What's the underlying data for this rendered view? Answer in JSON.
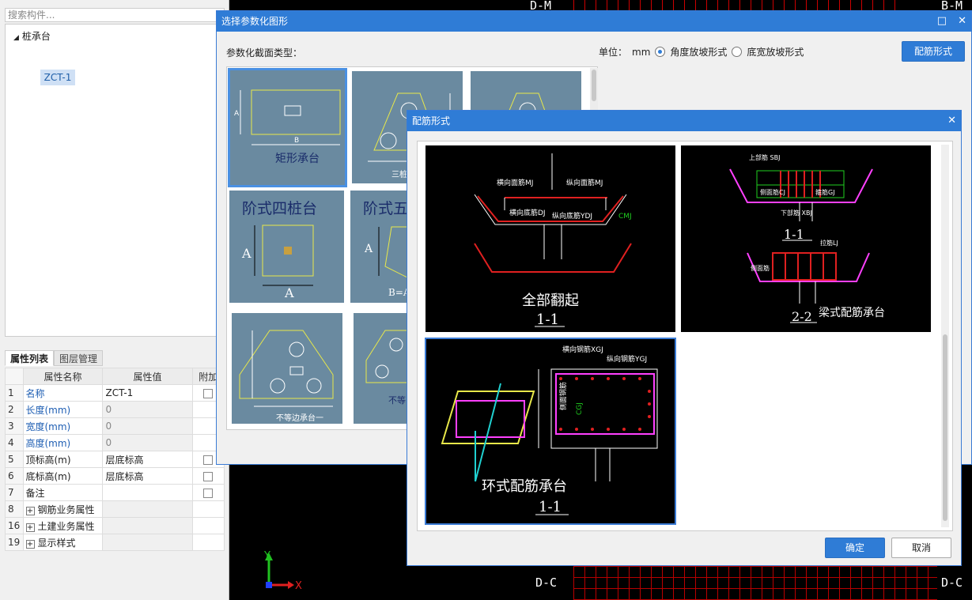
{
  "cad": {
    "labels_top": [
      "D-M",
      "B-M"
    ],
    "labels_bottom": [
      "D-C",
      "D-C"
    ],
    "axis": {
      "y": "Y",
      "x": "X"
    }
  },
  "left": {
    "search_placeholder": "搜索构件...",
    "tree_root": "桩承台",
    "tree_child": "ZCT-1",
    "tabs": [
      "属性列表",
      "图层管理"
    ],
    "columns": [
      "属性名称",
      "属性值",
      "附加"
    ],
    "rows": [
      {
        "n": "1",
        "name": "名称",
        "value": "ZCT-1",
        "blue": true,
        "gray": false,
        "chk": true,
        "plus": false
      },
      {
        "n": "2",
        "name": "长度(mm)",
        "value": "0",
        "blue": true,
        "gray": true,
        "chk": false,
        "plus": false
      },
      {
        "n": "3",
        "name": "宽度(mm)",
        "value": "0",
        "blue": true,
        "gray": true,
        "chk": false,
        "plus": false
      },
      {
        "n": "4",
        "name": "高度(mm)",
        "value": "0",
        "blue": true,
        "gray": true,
        "chk": false,
        "plus": false
      },
      {
        "n": "5",
        "name": "顶标高(m)",
        "value": "层底标高",
        "blue": false,
        "gray": false,
        "chk": true,
        "plus": false
      },
      {
        "n": "6",
        "name": "底标高(m)",
        "value": "层底标高",
        "blue": false,
        "gray": false,
        "chk": true,
        "plus": false
      },
      {
        "n": "7",
        "name": "备注",
        "value": "",
        "blue": false,
        "gray": false,
        "chk": true,
        "plus": false
      },
      {
        "n": "8",
        "name": "钢筋业务属性",
        "value": "",
        "blue": false,
        "gray": true,
        "chk": false,
        "plus": true
      },
      {
        "n": "16",
        "name": "土建业务属性",
        "value": "",
        "blue": false,
        "gray": true,
        "chk": false,
        "plus": true
      },
      {
        "n": "19",
        "name": "显示样式",
        "value": "",
        "blue": false,
        "gray": true,
        "chk": false,
        "plus": true
      }
    ]
  },
  "dialog1": {
    "title": "选择参数化图形",
    "section_label": "参数化截面类型：",
    "unit_label": "单位：",
    "unit_value": "mm",
    "option_angle": "角度放坡形式",
    "option_width": "底宽放坡形式",
    "rebar_button": "配筋形式",
    "tiles": {
      "rect": "矩形承台",
      "step4": "阶式四桩台",
      "step5": "阶式五",
      "tri": "三桩",
      "unequal1": "不等边承台一",
      "unequal2": "不等",
      "dimA": "A",
      "dimB": "B",
      "dimBA": "B=A"
    }
  },
  "dialog2": {
    "title": "配筋形式",
    "ok": "确定",
    "cancel": "取消",
    "img1": {
      "caption": "全部翻起",
      "section": "1-1",
      "l1": "横向面筋MJ",
      "l2": "纵向面筋MJ",
      "l3": "横向底筋DJ",
      "l4": "纵向底筋YDJ",
      "l5": "CMJ"
    },
    "img2": {
      "caption": "梁式配筋承台",
      "s1": "1-1",
      "s2": "2-2",
      "l1": "上部筋 SBJ",
      "l2": "侧面筋CJ",
      "l3": "箍筋GJ",
      "l4": "下部筋 XBJ",
      "l5": "拉筋LJ",
      "l6": "侧面筋"
    },
    "img3": {
      "caption": "环式配筋承台",
      "section": "1-1",
      "l1": "横向钢筋XGJ",
      "l2": "纵向钢筋YGJ",
      "l3": "侧面钢筋",
      "l4": "CGJ"
    }
  }
}
